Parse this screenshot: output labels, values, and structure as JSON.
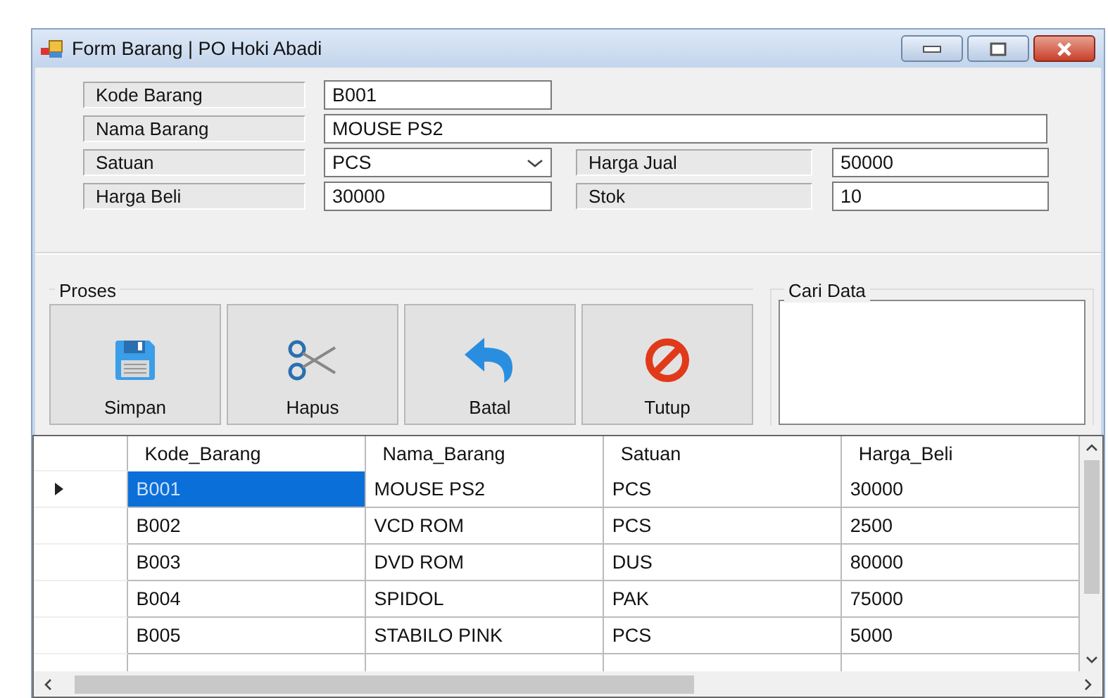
{
  "window": {
    "title": "Form Barang | PO Hoki Abadi"
  },
  "form": {
    "fields": [
      {
        "label": "Kode Barang",
        "value": "B001",
        "kind": "text"
      },
      {
        "label": "Nama Barang",
        "value": "MOUSE PS2",
        "kind": "text"
      },
      {
        "label": "Satuan",
        "value": "PCS",
        "kind": "combo"
      },
      {
        "label": "Harga Jual",
        "value": "50000",
        "kind": "text"
      },
      {
        "label": "Harga Beli",
        "value": "30000",
        "kind": "text"
      },
      {
        "label": "Stok",
        "value": "10",
        "kind": "text"
      }
    ]
  },
  "proses": {
    "title": "Proses",
    "buttons": [
      {
        "label": "Simpan"
      },
      {
        "label": "Hapus"
      },
      {
        "label": "Batal"
      },
      {
        "label": "Tutup"
      }
    ]
  },
  "search": {
    "title": "Cari Data"
  },
  "table": {
    "columns": [
      "Kode_Barang",
      "Nama_Barang",
      "Satuan",
      "Harga_Beli"
    ],
    "rows": [
      {
        "cells": [
          "B001",
          "MOUSE PS2",
          "PCS",
          "30000"
        ],
        "selected": true
      },
      {
        "cells": [
          "B002",
          "VCD ROM",
          "PCS",
          "2500"
        ],
        "selected": false
      },
      {
        "cells": [
          "B003",
          "DVD ROM",
          "DUS",
          "80000"
        ],
        "selected": false
      },
      {
        "cells": [
          "B004",
          "SPIDOL",
          "PAK",
          "75000"
        ],
        "selected": false
      },
      {
        "cells": [
          "B005",
          "STABILO PINK",
          "PCS",
          "5000"
        ],
        "selected": false
      }
    ]
  }
}
